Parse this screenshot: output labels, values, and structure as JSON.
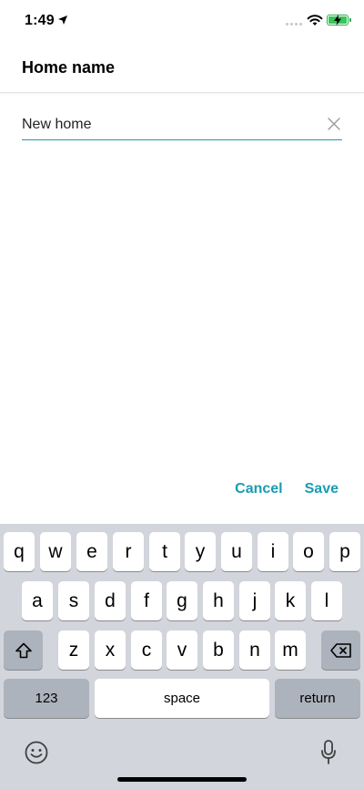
{
  "status_bar": {
    "time": "1:49"
  },
  "header": {
    "title": "Home name"
  },
  "name_field": {
    "value": "New home"
  },
  "actions": {
    "cancel": "Cancel",
    "save": "Save"
  },
  "keyboard": {
    "row1": [
      "q",
      "w",
      "e",
      "r",
      "t",
      "y",
      "u",
      "i",
      "o",
      "p"
    ],
    "row2": [
      "a",
      "s",
      "d",
      "f",
      "g",
      "h",
      "j",
      "k",
      "l"
    ],
    "row3": [
      "z",
      "x",
      "c",
      "v",
      "b",
      "n",
      "m"
    ],
    "numbers": "123",
    "space": "space",
    "return": "return"
  },
  "colors": {
    "accent": "#1a9cb0",
    "battery": "#34c759",
    "keyboard_bg": "#d2d5db"
  }
}
